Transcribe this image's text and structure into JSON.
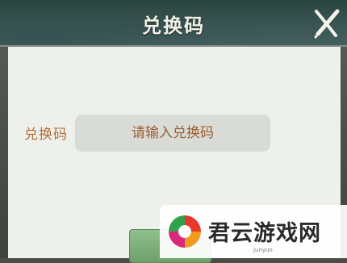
{
  "dialog": {
    "title": "兑换码",
    "close_icon": "close-brush-icon",
    "form": {
      "label": "兑换码",
      "input_value": "",
      "input_placeholder": "请输入兑换码"
    }
  },
  "watermark": {
    "text": "君云游戏网",
    "sub": "junyun",
    "logo_icon": "swirl-logo-icon"
  },
  "colors": {
    "title_bar": "#3b5552",
    "panel": "#eef0ec",
    "label": "#b26d3a",
    "input_bg": "#d9dbd6",
    "confirm": "#7fae7b"
  }
}
